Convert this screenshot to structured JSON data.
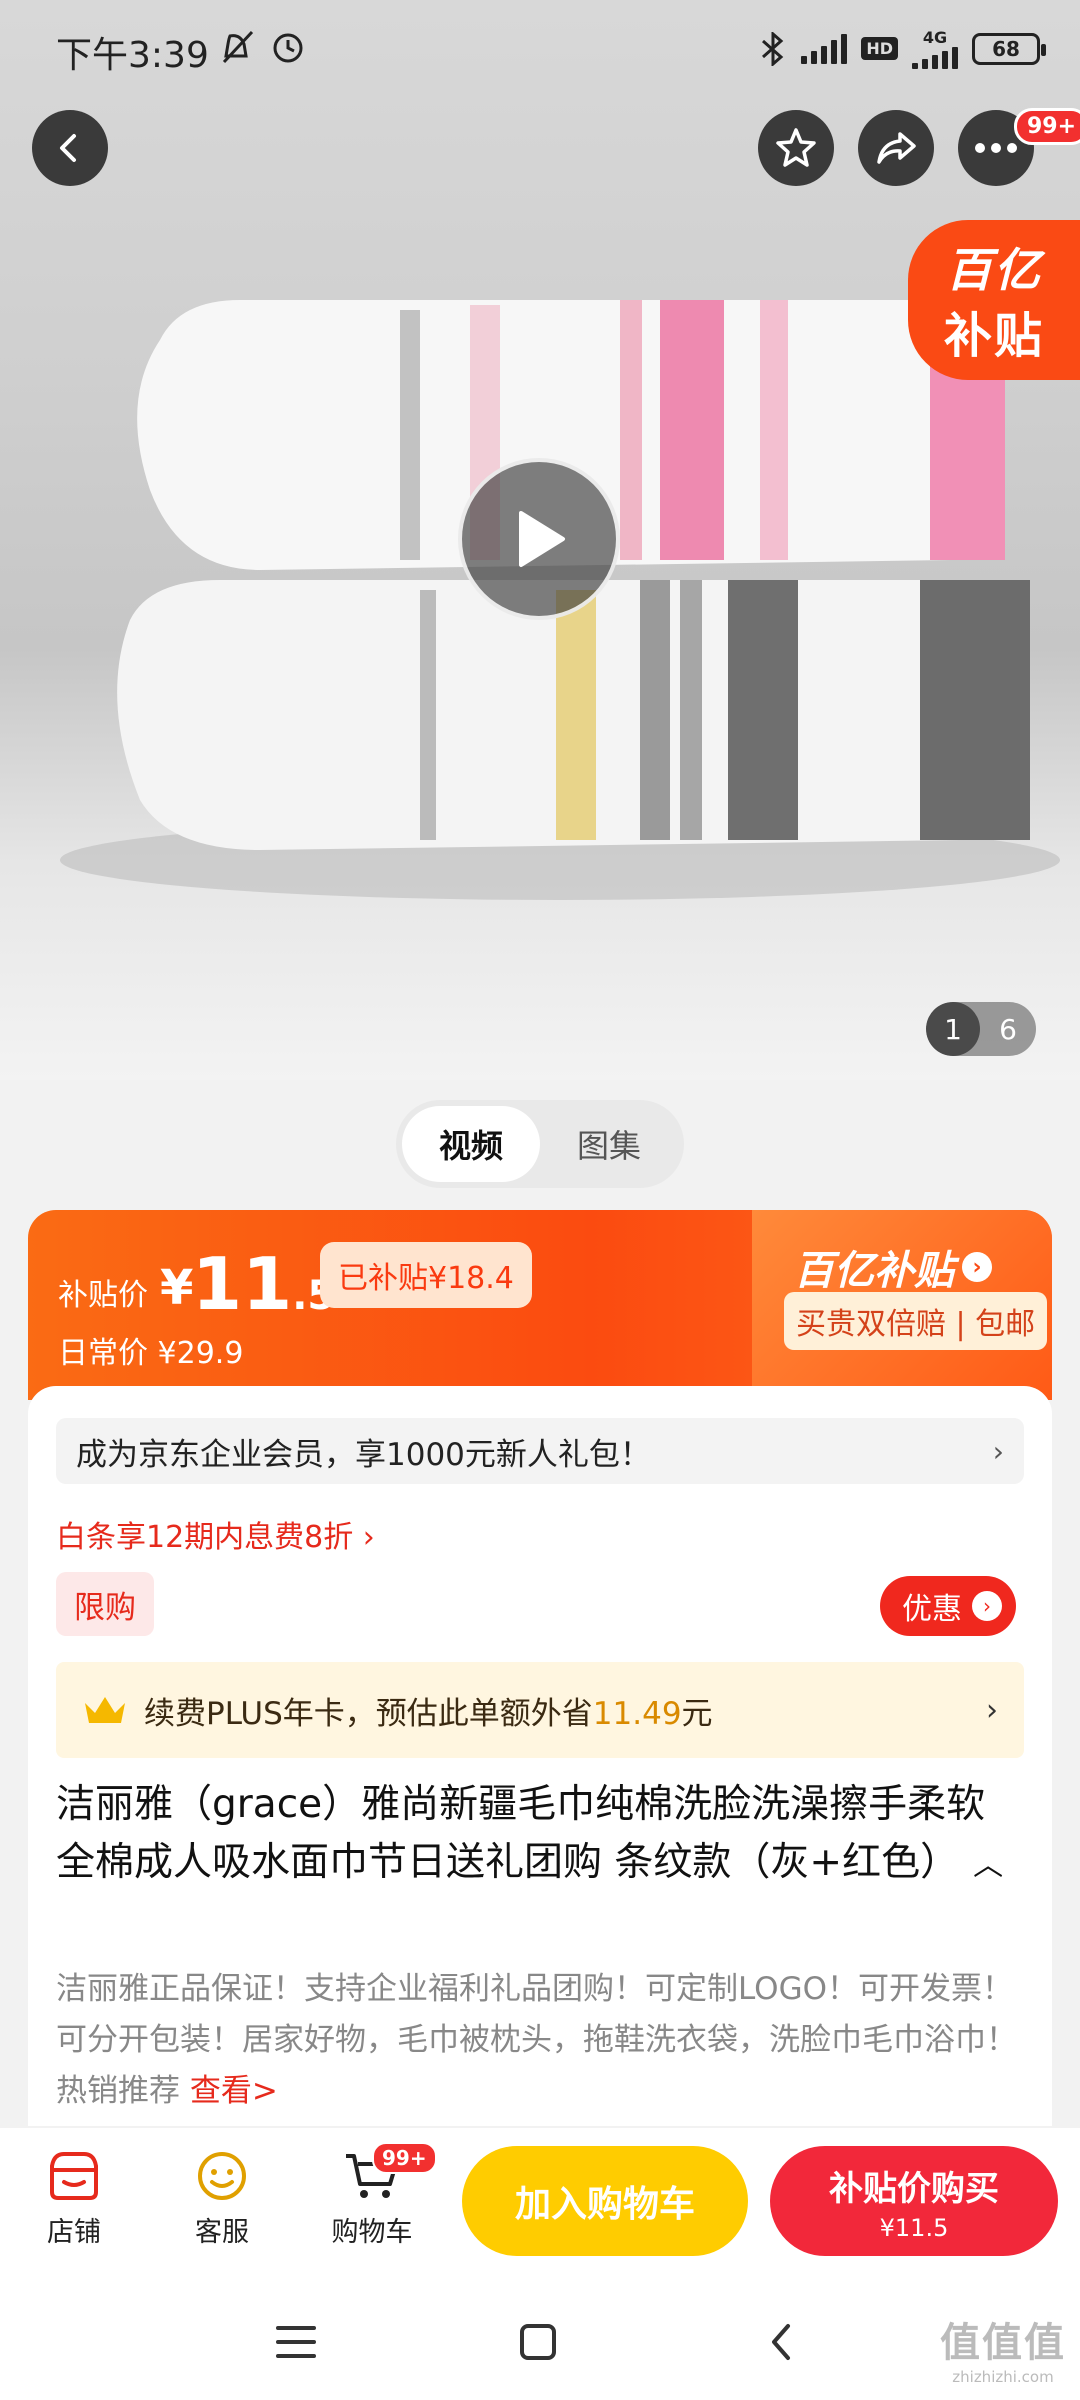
{
  "status_bar": {
    "time": "下午3:39",
    "network": "4G",
    "hd": "HD",
    "battery": "68"
  },
  "top_actions": {
    "more_badge": "99+"
  },
  "hero": {
    "subsidy_stamp_line1": "百亿",
    "subsidy_stamp_line2": "补贴",
    "pager_current": "1",
    "pager_total": "6"
  },
  "media_tabs": [
    {
      "label": "视频",
      "active": true
    },
    {
      "label": "图集",
      "active": false
    }
  ],
  "price": {
    "label": "补贴价",
    "currency": "¥",
    "value": "11",
    "decimal": ".5",
    "subsidized_badge": "已补贴¥18.4",
    "regular_label": "日常价",
    "regular_price": "¥29.9",
    "brand": "百亿补贴",
    "brand_tag": "买贵双倍赔 | 包邮"
  },
  "info": {
    "enterprise_text": "成为京东企业会员，享1000元新人礼包！",
    "baitiao_text": "白条享12期内息费8折 ›",
    "limit_tag": "限购",
    "promo_label": "优惠",
    "plus_prefix": "续费PLUS年卡，预估此单额外省",
    "plus_amount": "11.49",
    "plus_suffix": "元",
    "title": "洁丽雅（grace）雅尚新疆毛巾纯棉洗脸洗澡擦手柔软全棉成人吸水面巾节日送礼团购 条纹款（灰+红色）",
    "description": "洁丽雅正品保证！支持企业福利礼品团购！可定制LOGO！可开发票！可分开包装！居家好物，毛巾被枕头，拖鞋洗衣袋，洗脸巾毛巾浴巾！热销推荐 ",
    "see_more": "查看>"
  },
  "bottom_bar": {
    "shop": "店铺",
    "service": "客服",
    "cart": "购物车",
    "cart_badge": "99+",
    "add_to_cart": "加入购物车",
    "buy_line1": "补贴价购买",
    "buy_line2": "¥11.5"
  },
  "watermark": {
    "line1": "值值值",
    "line2": "zhizhizhi.com"
  },
  "colors": {
    "accent_red": "#f2283a",
    "subsidy_orange": "#fa4a14",
    "cart_yellow": "#ffcc00"
  }
}
